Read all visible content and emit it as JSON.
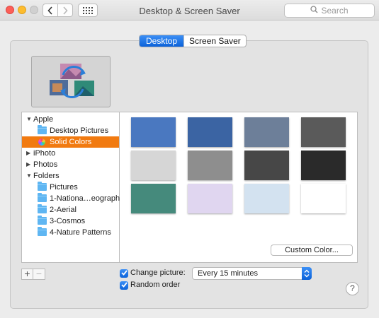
{
  "window": {
    "title": "Desktop & Screen Saver"
  },
  "search": {
    "placeholder": "Search"
  },
  "tabs": [
    {
      "label": "Desktop",
      "active": true
    },
    {
      "label": "Screen Saver",
      "active": false
    }
  ],
  "sidebar": {
    "items": [
      {
        "label": "Apple",
        "disclosure": "open"
      },
      {
        "label": "Desktop Pictures",
        "icon": "folder-icon"
      },
      {
        "label": "Solid Colors",
        "icon": "color-wheel-icon",
        "selected": true
      },
      {
        "label": "iPhoto",
        "disclosure": "closed"
      },
      {
        "label": "Photos",
        "disclosure": "closed"
      },
      {
        "label": "Folders",
        "disclosure": "open"
      },
      {
        "label": "Pictures",
        "icon": "folder-icon"
      },
      {
        "label": "1-Nationa…eographic",
        "icon": "folder-icon"
      },
      {
        "label": "2-Aerial",
        "icon": "folder-icon"
      },
      {
        "label": "3-Cosmos",
        "icon": "folder-icon"
      },
      {
        "label": "4-Nature Patterns",
        "icon": "folder-icon"
      }
    ]
  },
  "swatches": [
    "#4a78c0",
    "#3b64a3",
    "#6d7f99",
    "#5a5a5a",
    "#d6d6d6",
    "#8e8e8e",
    "#474747",
    "#2a2a2a",
    "#458a7c",
    "#e0d6f0",
    "#d3e2f0",
    "#ffffff"
  ],
  "custom_color_label": "Custom Color...",
  "change_picture": {
    "label": "Change picture:",
    "checked": true,
    "interval": "Every 15 minutes"
  },
  "random_order": {
    "label": "Random order",
    "checked": true
  },
  "add_button": "+",
  "remove_button": "−",
  "help": "?"
}
